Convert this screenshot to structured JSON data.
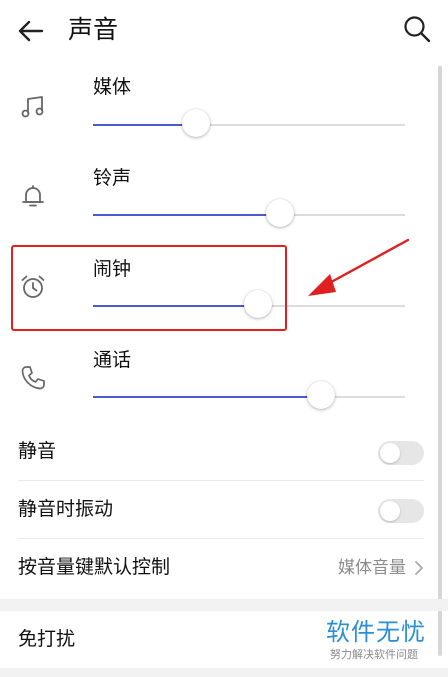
{
  "header": {
    "title": "声音",
    "back_icon": "arrow-left-icon",
    "search_icon": "search-icon"
  },
  "volume_sliders": [
    {
      "id": "media",
      "label": "媒体",
      "icon": "music-note-icon",
      "level": 0.33
    },
    {
      "id": "ringtone",
      "label": "铃声",
      "icon": "bell-icon",
      "level": 0.6
    },
    {
      "id": "alarm",
      "label": "闹钟",
      "icon": "alarm-clock-icon",
      "level": 0.53
    },
    {
      "id": "call",
      "label": "通话",
      "icon": "phone-icon",
      "level": 0.73
    }
  ],
  "settings": {
    "mute": {
      "label": "静音",
      "on": false
    },
    "vibrate_on_mute": {
      "label": "静音时振动",
      "on": false
    },
    "volume_key_default": {
      "label": "按音量键默认控制",
      "value": "媒体音量"
    },
    "do_not_disturb": {
      "label": "免打扰"
    }
  },
  "watermark": {
    "main": "软件无忧",
    "sub": "努力解决软件问题"
  },
  "colors": {
    "accent": "#4a5bd0",
    "annotation": "#e02020",
    "watermark": "#2a8fd4"
  }
}
